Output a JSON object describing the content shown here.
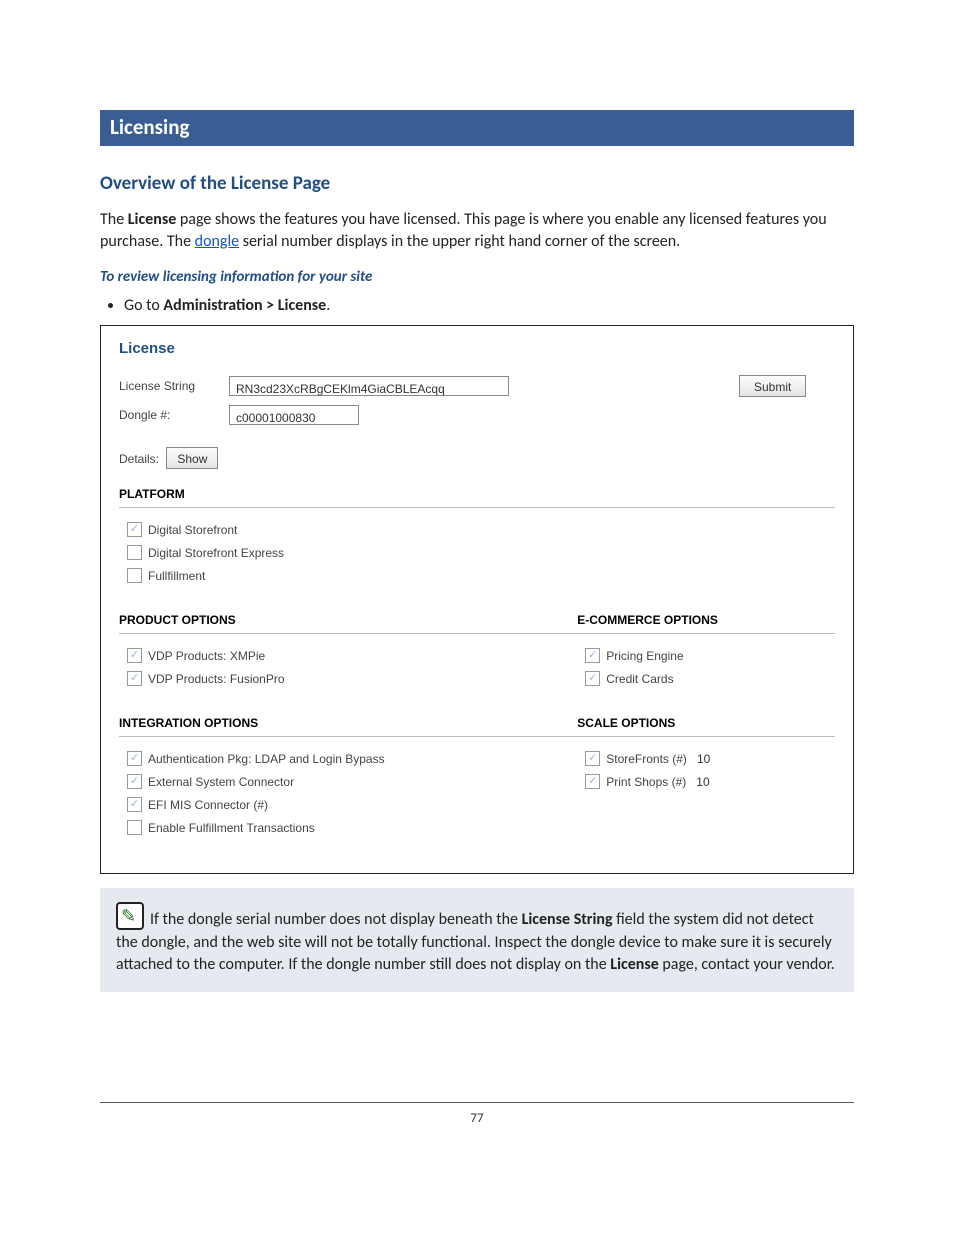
{
  "heading_bar": "Licensing",
  "subheading": "Overview of the License Page",
  "intro": {
    "p1a": "The ",
    "p1b": "License",
    "p1c": " page shows the features you have licensed. This page is where you enable any licensed features you purchase. The ",
    "link": "dongle",
    "p1d": " serial number displays in the upper right hand corner of the screen."
  },
  "subproc": "To review licensing information for your site",
  "bullet": {
    "prefix": "Go to ",
    "path": "Administration > License",
    "suffix": "."
  },
  "shot": {
    "title": "License",
    "license_label": "License String",
    "license_value": "RN3cd23XcRBgCEKlm4GiaCBLEAcqq",
    "submit": "Submit",
    "dongle_label": "Dongle #:",
    "dongle_value": "c00001000830",
    "details_label": "Details:",
    "show": "Show",
    "sections": {
      "platform_head": "PLATFORM",
      "platform": [
        {
          "label": "Digital Storefront",
          "checked": true
        },
        {
          "label": "Digital Storefront Express",
          "checked": false
        },
        {
          "label": "Fullfillment",
          "checked": false
        }
      ],
      "product_head": "PRODUCT OPTIONS",
      "ecom_head": "E-COMMERCE OPTIONS",
      "product": [
        {
          "label": "VDP Products: XMPie",
          "checked": true
        },
        {
          "label": "VDP Products: FusionPro",
          "checked": true
        }
      ],
      "ecom": [
        {
          "label": "Pricing Engine",
          "checked": true
        },
        {
          "label": "Credit Cards",
          "checked": true
        }
      ],
      "integration_head": "INTEGRATION OPTIONS",
      "scale_head": "SCALE OPTIONS",
      "integration": [
        {
          "label": "Authentication Pkg: LDAP and Login Bypass",
          "checked": true
        },
        {
          "label": "External System Connector",
          "checked": true
        },
        {
          "label": "EFI MIS Connector (#)",
          "checked": true
        },
        {
          "label": "Enable Fulfillment Transactions",
          "checked": false
        }
      ],
      "scale": [
        {
          "label": "StoreFronts (#)",
          "checked": true,
          "num": "10"
        },
        {
          "label": "Print Shops (#)",
          "checked": true,
          "num": "10"
        }
      ]
    }
  },
  "note": {
    "t1": "If the dongle serial number does not display beneath the ",
    "b1": "License String",
    "t2": " field the system did not detect the dongle, and the web site will not be totally functional. Inspect the dongle device to make sure it is securely attached to the computer. If the dongle number still does not display on the ",
    "b2": "License",
    "t3": " page, contact your vendor."
  },
  "page_number": "77"
}
